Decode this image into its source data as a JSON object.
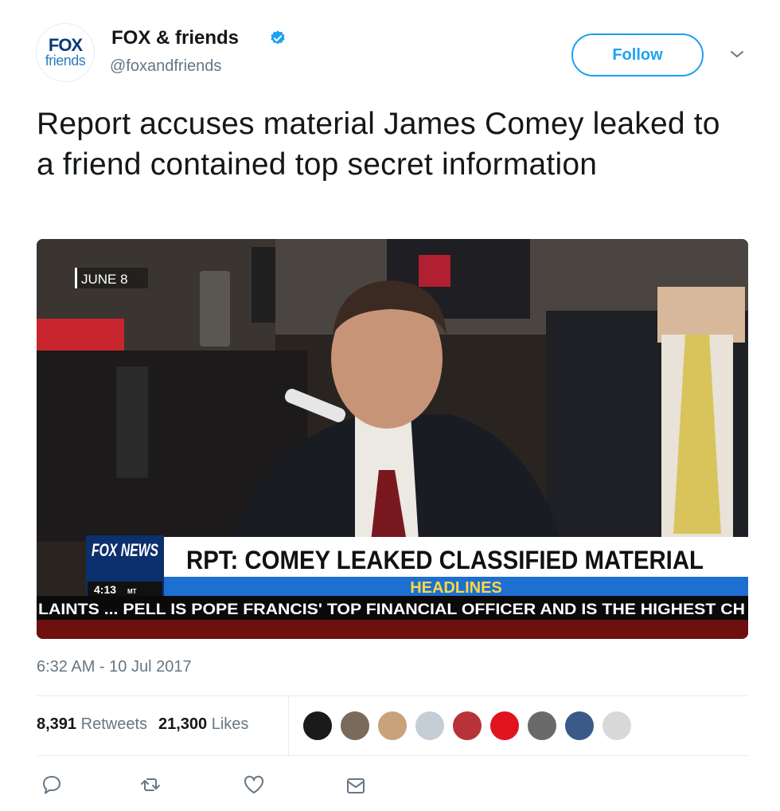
{
  "header": {
    "avatar_logo_top": "FOX",
    "avatar_logo_bottom": "friends",
    "name": "FOX & friends",
    "handle": "@foxandfriends",
    "follow_label": "Follow"
  },
  "tweet": {
    "text": "Report accuses material James Comey leaked to a friend contained top secret information",
    "timestamp": "6:32 AM - 10 Jul 2017"
  },
  "media": {
    "date_tag": "JUNE 8",
    "network_logo": "FOX NEWS",
    "clock": "4:13",
    "clock_zone": "MT",
    "headline": "RPT: COMEY LEAKED CLASSIFIED MATERIAL",
    "segment": "HEADLINES",
    "ticker": "LAINTS ... PELL IS POPE FRANCIS' TOP FINANCIAL OFFICER AND IS THE HIGHEST CH"
  },
  "stats": {
    "retweets_count": "8,391",
    "retweets_label": "Retweets",
    "likes_count": "21,300",
    "likes_label": "Likes"
  },
  "likers": [
    {
      "name": "liker-1",
      "color": "#1a1a1a"
    },
    {
      "name": "liker-2",
      "color": "#7a6a5a"
    },
    {
      "name": "liker-3",
      "color": "#c9a27a"
    },
    {
      "name": "liker-4",
      "color": "#c5cdd6"
    },
    {
      "name": "liker-5",
      "color": "#b8323a"
    },
    {
      "name": "liker-6",
      "color": "#e0141e"
    },
    {
      "name": "liker-7",
      "color": "#6a6a6a"
    },
    {
      "name": "liker-8",
      "color": "#3a5a8a"
    },
    {
      "name": "liker-9",
      "color": "#d8d8d8"
    }
  ],
  "colors": {
    "accent": "#1da1f2",
    "text": "#14171a",
    "muted": "#657786",
    "verified": "#1da1f2"
  }
}
